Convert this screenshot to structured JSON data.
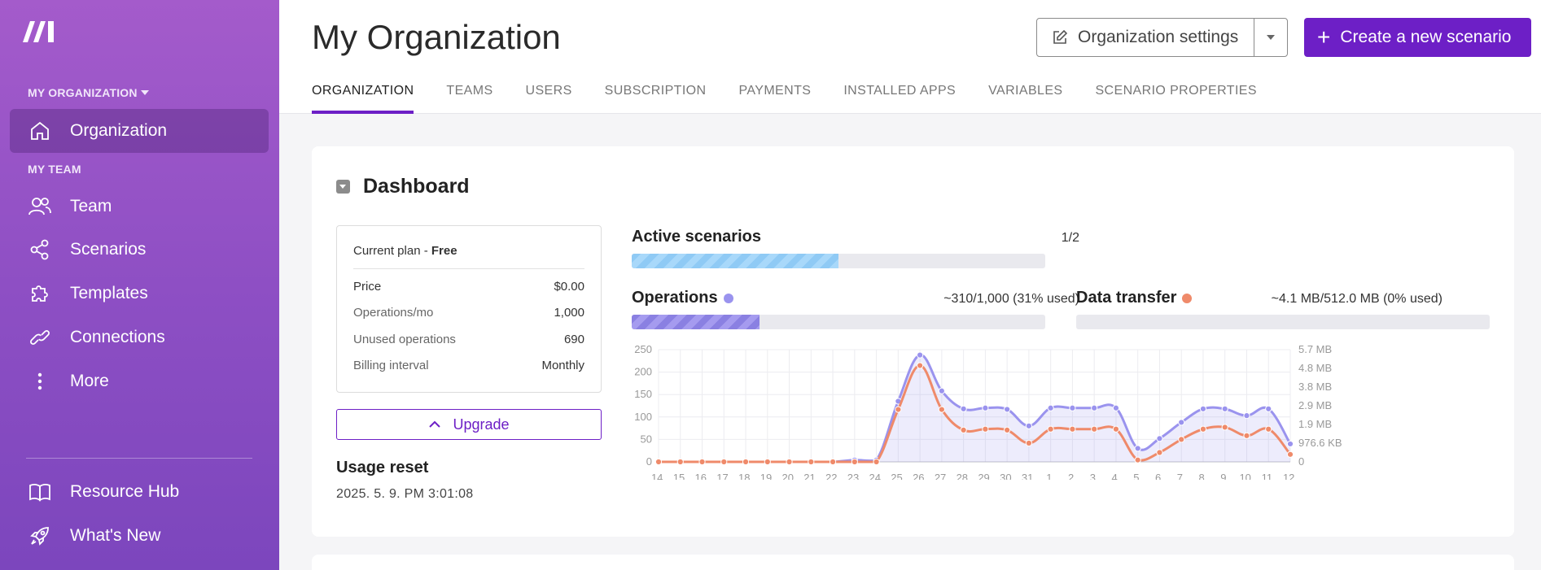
{
  "sidebar": {
    "org_section_label": "MY ORGANIZATION",
    "team_section_label": "MY TEAM",
    "items": [
      {
        "label": "Organization",
        "icon": "home-icon",
        "active": true
      },
      {
        "label": "Team",
        "icon": "users-icon"
      },
      {
        "label": "Scenarios",
        "icon": "share-nodes-icon"
      },
      {
        "label": "Templates",
        "icon": "puzzle-icon"
      },
      {
        "label": "Connections",
        "icon": "link-icon"
      },
      {
        "label": "More",
        "icon": "more-vertical-icon"
      }
    ],
    "bottom_items": [
      {
        "label": "Resource Hub",
        "icon": "book-icon"
      },
      {
        "label": "What's New",
        "icon": "rocket-icon"
      }
    ]
  },
  "header": {
    "title": "My Organization",
    "settings_button": "Organization settings",
    "create_button": "Create a new scenario",
    "tabs": [
      {
        "label": "ORGANIZATION",
        "active": true
      },
      {
        "label": "TEAMS"
      },
      {
        "label": "USERS"
      },
      {
        "label": "SUBSCRIPTION"
      },
      {
        "label": "PAYMENTS"
      },
      {
        "label": "INSTALLED APPS"
      },
      {
        "label": "VARIABLES"
      },
      {
        "label": "SCENARIO PROPERTIES"
      }
    ]
  },
  "dashboard": {
    "title": "Dashboard",
    "plan": {
      "label": "Current plan - ",
      "name": "Free",
      "rows": [
        {
          "key": "Price",
          "value": "$0.00"
        },
        {
          "key": "Operations/mo",
          "value": "1,000"
        },
        {
          "key": "Unused operations",
          "value": "690"
        },
        {
          "key": "Billing interval",
          "value": "Monthly"
        }
      ]
    },
    "upgrade_button": "Upgrade",
    "usage_reset_label": "Usage reset",
    "usage_reset_value": "2025. 5. 9. PM 3:01:08",
    "active_scenarios": {
      "label": "Active scenarios",
      "value": "1/2",
      "fraction": 0.5
    },
    "operations": {
      "label": "Operations",
      "value": "~310/1,000 (31% used)",
      "fraction": 0.31
    },
    "data_transfer": {
      "label": "Data transfer",
      "value": "~4.1 MB/512.0 MB (0% used)",
      "fraction": 0.0
    },
    "colors": {
      "operations": "#9a93ee",
      "data_transfer": "#ef8a6a",
      "accent": "#6d1fc6"
    }
  },
  "chart_data": {
    "type": "line",
    "x": [
      "14.",
      "15.",
      "16.",
      "17.",
      "18.",
      "19.",
      "20.",
      "21.",
      "22.",
      "23.",
      "24.",
      "25.",
      "26.",
      "27.",
      "28.",
      "29.",
      "30.",
      "31.",
      "1.",
      "2.",
      "3.",
      "4.",
      "5.",
      "6.",
      "7.",
      "8.",
      "9.",
      "10.",
      "11.",
      "12."
    ],
    "y_left_ticks": [
      "0",
      "50",
      "100",
      "150",
      "200",
      "250"
    ],
    "y_right_ticks": [
      "0",
      "976.6 KB",
      "1.9 MB",
      "2.9 MB",
      "3.8 MB",
      "4.8 MB",
      "5.7 MB"
    ],
    "ylim_left": [
      0,
      250
    ],
    "ylim_right": [
      0,
      6
    ],
    "grid": true,
    "series": [
      {
        "name": "Operations",
        "axis": "left",
        "values": [
          0,
          0,
          0,
          0,
          0,
          0,
          0,
          0,
          0,
          4,
          4,
          135,
          238,
          158,
          118,
          120,
          117,
          80,
          120,
          120,
          120,
          120,
          30,
          52,
          88,
          118,
          118,
          103,
          118,
          40
        ]
      },
      {
        "name": "Data transfer",
        "axis": "right",
        "values": [
          0,
          0,
          0,
          0,
          0,
          0,
          0,
          0,
          0,
          0,
          0,
          2.8,
          5.15,
          2.8,
          1.7,
          1.75,
          1.7,
          1.0,
          1.75,
          1.75,
          1.75,
          1.75,
          0.1,
          0.5,
          1.2,
          1.75,
          1.85,
          1.4,
          1.75,
          0.4
        ]
      }
    ]
  }
}
